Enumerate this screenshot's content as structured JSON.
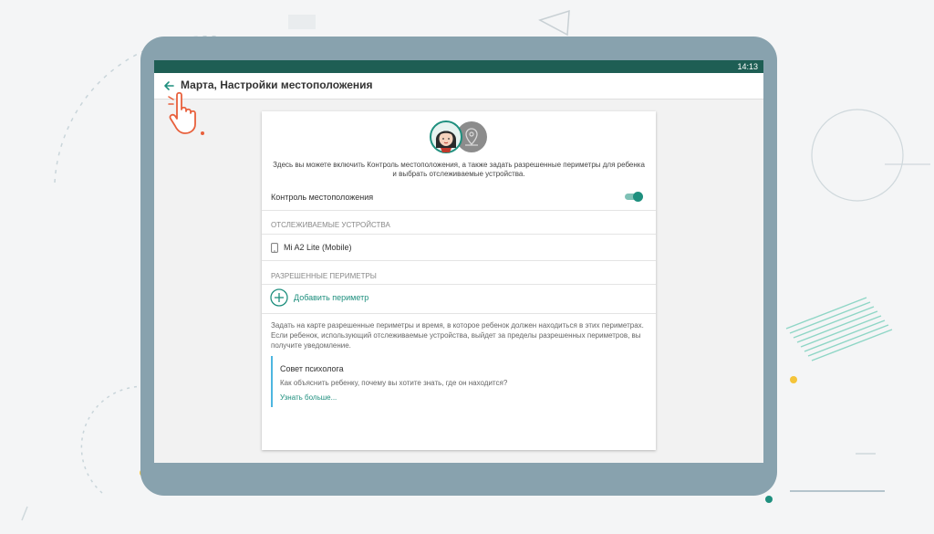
{
  "status_bar": {
    "time": "14:13"
  },
  "app_bar": {
    "title": "Марта, Настройки местоположения"
  },
  "card": {
    "intro": "Здесь вы можете включить Контроль местоположения, а также задать разрешенные периметры для ребенка и выбрать отслеживаемые устройства.",
    "location_control": {
      "label": "Контроль местоположения",
      "enabled": true
    },
    "tracked_devices": {
      "header": "ОТСЛЕЖИВАЕМЫЕ УСТРОЙСТВА",
      "items": [
        {
          "name": "Mi A2 Lite (Mobile)",
          "icon": "smartphone-icon"
        }
      ]
    },
    "perimeters": {
      "header": "РАЗРЕШЕННЫЕ ПЕРИМЕТРЫ",
      "add_label": "Добавить периметр",
      "description": "Задать на карте разрешенные периметры и время, в которое ребенок должен находиться в этих периметрах. Если ребенок, использующий отслеживаемые устройства, выйдет за пределы разрешенных периметров, вы получите уведомление."
    },
    "tip": {
      "title": "Совет психолога",
      "text": "Как объяснить ребенку, почему вы хотите знать, где он находится?",
      "link": "Узнать больше..."
    }
  },
  "colors": {
    "accent": "#1e8f7e",
    "status_bar": "#1e5e54",
    "tablet_frame": "#88a2ae",
    "tip_border": "#4db6e0"
  },
  "icons": {
    "back": "arrow-left-icon",
    "add": "plus-circle-icon",
    "device": "smartphone-icon",
    "avatar_location": "location-pin-icon"
  }
}
